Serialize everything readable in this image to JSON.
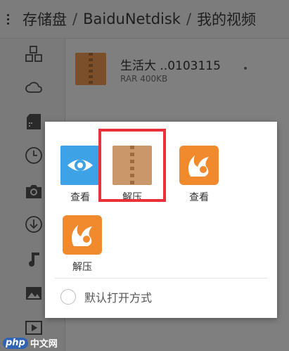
{
  "breadcrumb": {
    "items": [
      "存储盘",
      "BaiduNetdisk",
      "我的视频"
    ],
    "separator": "/"
  },
  "sidebar": {
    "icons": [
      "apps-icon",
      "cloud-icon",
      "sd-card-icon",
      "clock-icon",
      "camera-icon",
      "download-icon",
      "music-icon",
      "image-icon",
      "video-icon"
    ]
  },
  "file": {
    "name": "生活大 ..0103115",
    "meta": "RAR 400KB"
  },
  "dialog": {
    "apps": [
      {
        "label": "查看",
        "icon": "eye-icon"
      },
      {
        "label": "解压",
        "icon": "archive-icon"
      },
      {
        "label": "查看",
        "icon": "uc-browser-icon"
      },
      {
        "label": "解压",
        "icon": "uc-browser-icon"
      }
    ],
    "default_option": "默认打开方式"
  },
  "watermark": {
    "logo": "php",
    "text": "中文网"
  },
  "colors": {
    "eye_blue": "#3da2e6",
    "archive_brown": "#c9976a",
    "uc_orange": "#f08a2c",
    "highlight_red": "#e8313a",
    "dim_overlay": "#7f7f7f"
  }
}
